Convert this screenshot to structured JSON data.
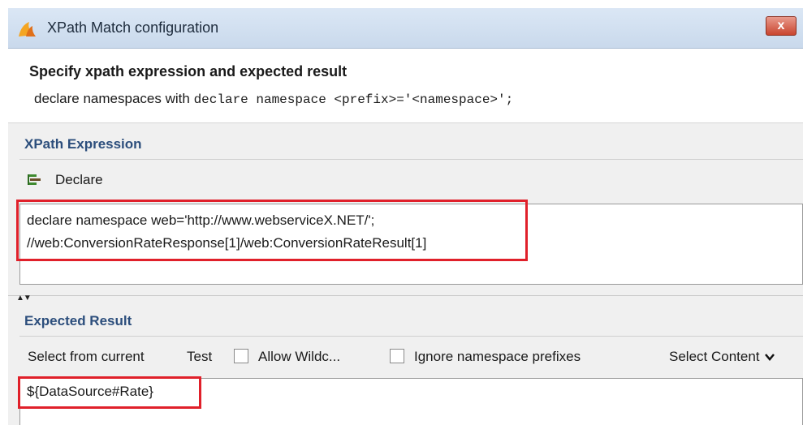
{
  "window": {
    "title": "XPath Match configuration",
    "close_label": "x"
  },
  "header": {
    "title": "Specify xpath expression and expected result",
    "hint_prefix": "declare namespaces with",
    "hint_code": "declare namespace <prefix>='<namespace>';"
  },
  "xpath_section": {
    "title": "XPath Expression",
    "declare_label": "Declare",
    "expression_lines": [
      "declare namespace web='http://www.webserviceX.NET/';",
      "//web:ConversionRateResponse[1]/web:ConversionRateResult[1]"
    ]
  },
  "splitter": {
    "arrows": "▲▼"
  },
  "expected_section": {
    "title": "Expected Result",
    "select_from_current_label": "Select from current",
    "test_label": "Test",
    "allow_wildcards_label": "Allow Wildc...",
    "allow_wildcards_checked": false,
    "ignore_ns_label": "Ignore namespace prefixes",
    "ignore_ns_checked": false,
    "select_content_label": "Select Content",
    "select_content_icon": "chevron-down-icon",
    "result_value": "${DataSource#Rate}"
  },
  "colors": {
    "highlight_border": "#e0202a",
    "section_title": "#2c4e7c",
    "close_button": "#c9452f"
  }
}
